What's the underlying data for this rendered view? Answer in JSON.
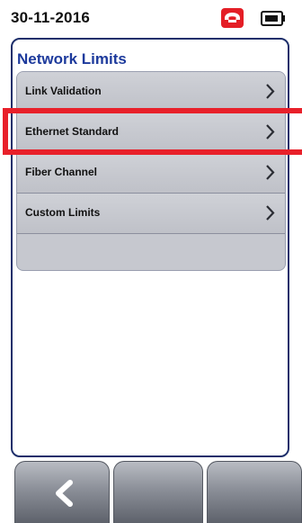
{
  "statusbar": {
    "date": "30-11-2016",
    "call_icon": "phone-hangup-icon",
    "call_color": "#e41e26",
    "battery_icon": "battery-icon"
  },
  "screen": {
    "title": "Network Limits",
    "title_color": "#1d3a9c",
    "items": [
      {
        "label": "Link Validation",
        "icon": "chevron-right-icon"
      },
      {
        "label": "Ethernet Standard",
        "icon": "chevron-right-icon",
        "highlighted": true
      },
      {
        "label": "Fiber Channel",
        "icon": "chevron-right-icon"
      },
      {
        "label": "Custom Limits",
        "icon": "chevron-right-icon"
      }
    ],
    "highlight_color": "#e8202a"
  },
  "softkeys": [
    {
      "icon": "back-arrow-icon",
      "label": ""
    },
    {
      "icon": "",
      "label": ""
    },
    {
      "icon": "",
      "label": ""
    }
  ]
}
